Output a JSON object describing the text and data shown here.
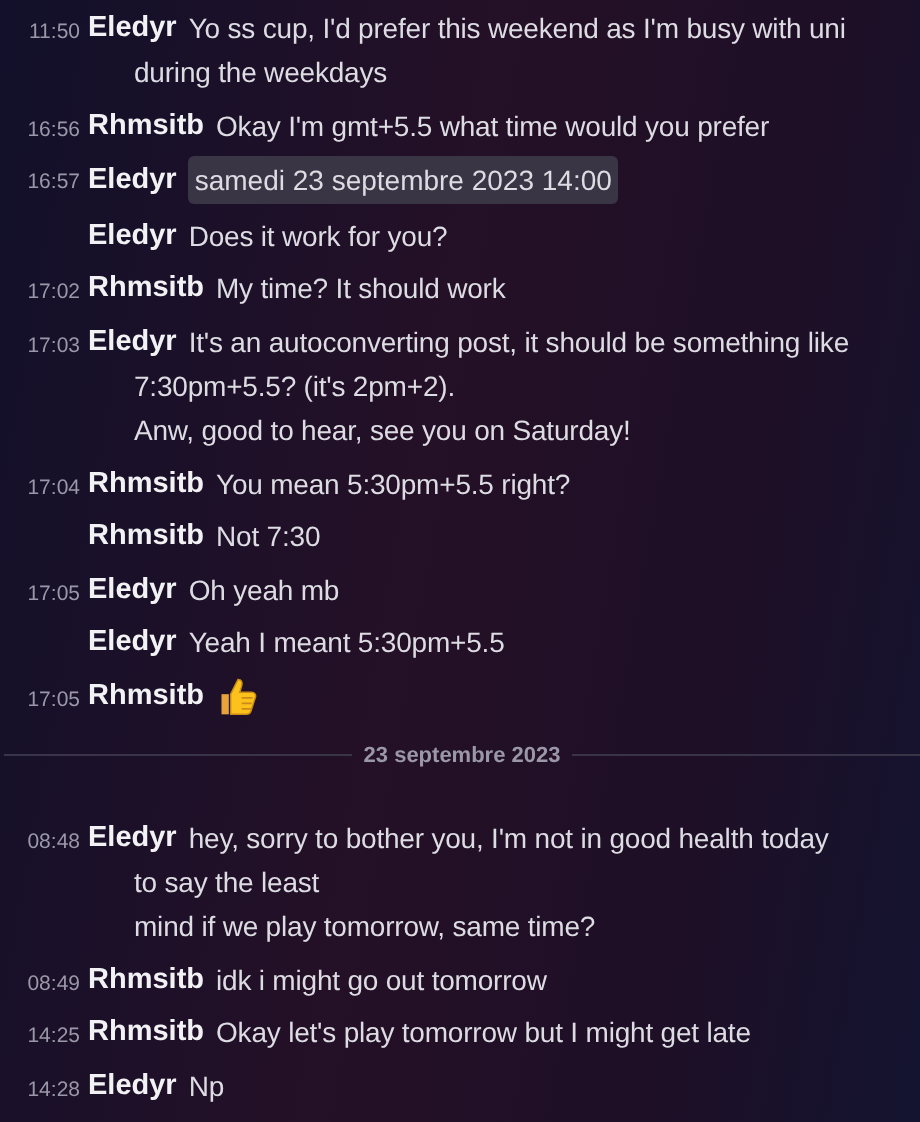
{
  "messages_before": [
    {
      "time": "11:50",
      "author": "Eledyr",
      "kind": "text",
      "lines": [
        "Yo ss cup, I'd prefer this weekend as I'm busy with uni",
        "during the weekdays"
      ]
    },
    {
      "time": "16:56",
      "author": "Rhmsitb",
      "kind": "text",
      "lines": [
        "Okay I'm gmt+5.5 what time would you prefer"
      ]
    },
    {
      "time": "16:57",
      "author": "Eledyr",
      "kind": "timestamp",
      "lines": [
        "samedi 23 septembre 2023 14:00"
      ]
    },
    {
      "author": "Eledyr",
      "kind": "text",
      "lines": [
        "Does it work for you?"
      ]
    },
    {
      "time": "17:02",
      "author": "Rhmsitb",
      "kind": "text",
      "lines": [
        "My time? It should work"
      ]
    },
    {
      "time": "17:03",
      "author": "Eledyr",
      "kind": "text",
      "lines": [
        "It's an autoconverting post, it should be something like",
        "7:30pm+5.5? (it's 2pm+2).",
        "Anw, good to hear, see you on Saturday!"
      ]
    },
    {
      "time": "17:04",
      "author": "Rhmsitb",
      "kind": "text",
      "lines": [
        "You mean 5:30pm+5.5 right?"
      ]
    },
    {
      "author": "Rhmsitb",
      "kind": "text",
      "lines": [
        "Not 7:30"
      ]
    },
    {
      "time": "17:05",
      "author": "Eledyr",
      "kind": "text",
      "lines": [
        "Oh yeah mb"
      ]
    },
    {
      "author": "Eledyr",
      "kind": "text",
      "lines": [
        "Yeah I meant 5:30pm+5.5"
      ]
    },
    {
      "time": "17:05",
      "author": "Rhmsitb",
      "kind": "thumbs_up"
    }
  ],
  "date_divider": "23 septembre 2023",
  "messages_after": [
    {
      "time": "08:48",
      "author": "Eledyr",
      "kind": "text",
      "lines": [
        "hey, sorry to bother you, I'm not in good health today",
        "to say the least",
        "mind if we play tomorrow, same time?"
      ]
    },
    {
      "time": "08:49",
      "author": "Rhmsitb",
      "kind": "text",
      "lines": [
        "idk i might go out tomorrow"
      ]
    },
    {
      "time": "14:25",
      "author": "Rhmsitb",
      "kind": "text",
      "lines": [
        "Okay let's play tomorrow but I might get late"
      ]
    },
    {
      "time": "14:28",
      "author": "Eledyr",
      "kind": "text",
      "lines": [
        "Np"
      ]
    }
  ]
}
